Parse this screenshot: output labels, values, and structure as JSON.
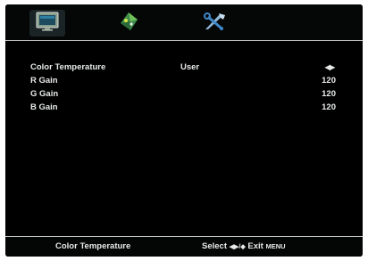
{
  "tabs": [
    {
      "icon": "monitor-icon",
      "active": true
    },
    {
      "icon": "palette-icon",
      "active": false
    },
    {
      "icon": "tools-icon",
      "active": false
    }
  ],
  "menu": {
    "color_temperature": {
      "label": "Color Temperature",
      "value": "User",
      "arrows": "◀▶"
    },
    "r_gain": {
      "label": "R Gain",
      "value": "120"
    },
    "g_gain": {
      "label": "G Gain",
      "value": "120"
    },
    "b_gain": {
      "label": "B Gain",
      "value": "120"
    }
  },
  "footer": {
    "title": "Color Temperature",
    "select_label": "Select",
    "select_keys": "◀▶/◆",
    "exit_label": "Exit",
    "exit_key": "MENU"
  },
  "colors": {
    "background": "#000000",
    "text": "#e8eaea",
    "divider": "#bfc3c4"
  }
}
